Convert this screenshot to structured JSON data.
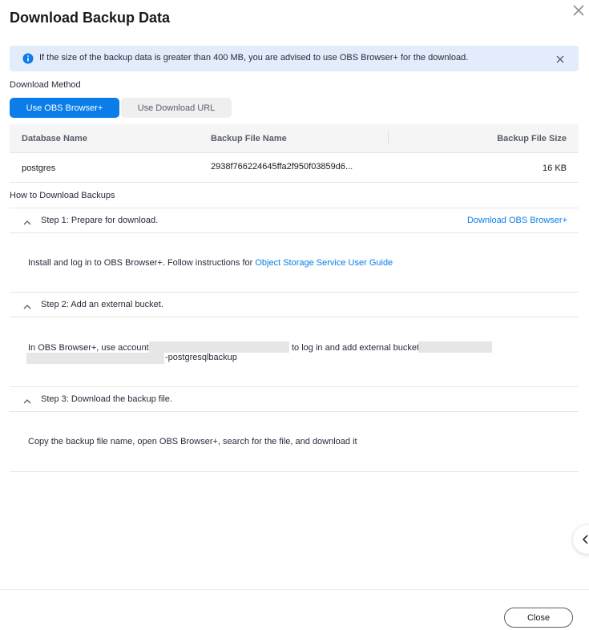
{
  "dialog": {
    "title": "Download Backup Data",
    "close_label": "Close"
  },
  "alert": {
    "message": "If the size of the backup data is greater than 400 MB, you are advised to use OBS Browser+ for the download."
  },
  "download_method": {
    "label": "Download Method",
    "options": [
      "Use OBS Browser+",
      "Use Download URL"
    ],
    "selected": "Use OBS Browser+"
  },
  "table": {
    "headers": [
      "Database Name",
      "Backup File Name",
      "Backup File Size"
    ],
    "rows": [
      [
        "postgres",
        "2938f766224645ffa2f950f03859d6...",
        "16 KB"
      ]
    ]
  },
  "how_to": {
    "label": "How to Download Backups",
    "steps": [
      {
        "title": "Step 1: Prepare for download.",
        "link": "Download OBS Browser+",
        "text": "Install and log in to OBS Browser+. Follow instructions for ",
        "text_link": "Object Storage Service User Guide"
      },
      {
        "title": "Step 2: Add an external bucket.",
        "text_a": "In OBS Browser+, use account",
        "text_b": "to log in and add external bucket",
        "text_c": "-postgresqlbackup"
      },
      {
        "title": "Step 3: Download the backup file.",
        "text": "Copy the backup file name, open OBS Browser+, search for the file, and download it"
      }
    ]
  },
  "colors": {
    "primary": "#0a7de8",
    "alert_bg": "#e3ecfa",
    "text": "#252b3a"
  },
  "icons": [
    "close-icon",
    "info-icon",
    "chevron-up-icon",
    "chevron-left-icon"
  ]
}
